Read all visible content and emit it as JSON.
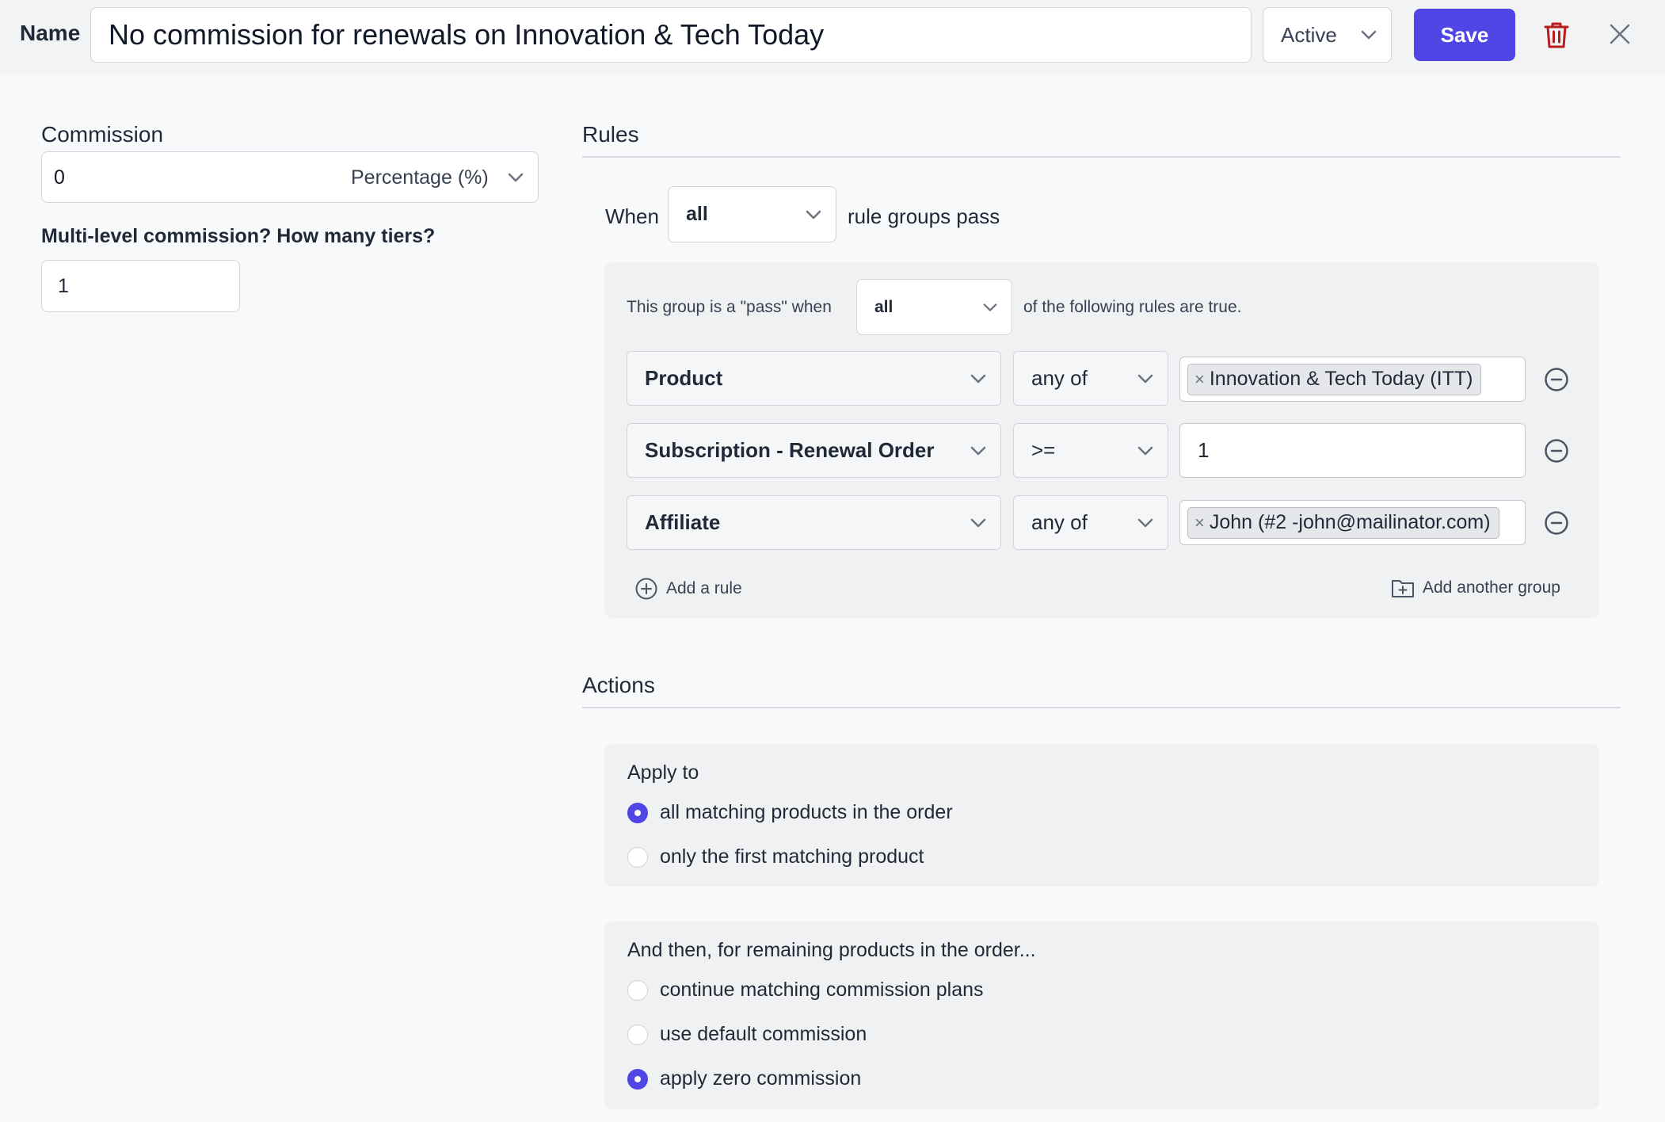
{
  "header": {
    "name_label": "Name",
    "name_value": "No commission for renewals on Innovation & Tech Today",
    "status_value": "Active",
    "save_label": "Save"
  },
  "commission": {
    "label": "Commission",
    "value": "0",
    "unit": "Percentage (%)",
    "tiers_label": "Multi-level commission? How many tiers?",
    "tiers_value": "1"
  },
  "rules": {
    "title": "Rules",
    "when_label": "When",
    "when_value": "all",
    "when_suffix": "rule groups pass",
    "group": {
      "prefix": "This group is a \"pass\" when",
      "match_value": "all",
      "suffix": "of the following rules are true.",
      "rows": [
        {
          "field": "Product",
          "operator": "any of",
          "value": "Innovation & Tech Today (ITT)"
        },
        {
          "field": "Subscription - Renewal Order",
          "operator": ">=",
          "value": "1"
        },
        {
          "field": "Affiliate",
          "operator": "any of",
          "value": "John (#2 -john@mailinator.com)"
        }
      ],
      "add_rule_label": "Add a rule",
      "add_group_label": "Add another group"
    }
  },
  "actions": {
    "title": "Actions",
    "apply_to": {
      "heading": "Apply to",
      "options": [
        "all matching products in the order",
        "only the first matching product"
      ],
      "selected_index": 0
    },
    "remaining": {
      "heading": "And then, for remaining products in the order...",
      "options": [
        "continue matching commission plans",
        "use default commission",
        "apply zero commission"
      ],
      "selected_index": 2
    }
  },
  "colors": {
    "accent": "#4f46e5",
    "delete": "#b91c1c"
  }
}
